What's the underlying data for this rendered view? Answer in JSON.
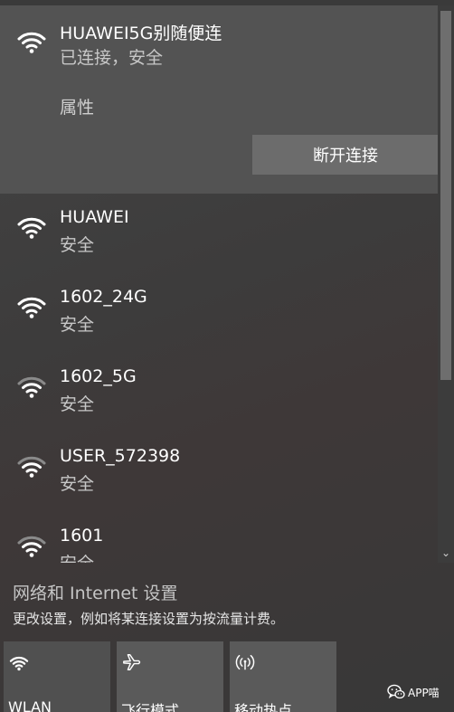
{
  "connected": {
    "name": "HUAWEI5G别随便连",
    "status": "已连接，安全",
    "properties_label": "属性",
    "disconnect_label": "断开连接",
    "icon": "wifi-strong-icon"
  },
  "networks": [
    {
      "name": "HUAWEI",
      "status": "安全",
      "icon": "wifi-strong-icon"
    },
    {
      "name": "1602_24G",
      "status": "安全",
      "icon": "wifi-strong-icon"
    },
    {
      "name": "1602_5G",
      "status": "安全",
      "icon": "wifi-medium-icon"
    },
    {
      "name": "USER_572398",
      "status": "安全",
      "icon": "wifi-medium-icon"
    },
    {
      "name": "1601",
      "status": "安全",
      "icon": "wifi-medium-icon"
    }
  ],
  "settings": {
    "title": "网络和 Internet 设置",
    "description": "更改设置，例如将某连接设置为按流量计费。"
  },
  "quick_actions": [
    {
      "label": "WLAN",
      "icon": "wifi-icon",
      "active": true,
      "color": "#505050"
    },
    {
      "label": "飞行模式",
      "icon": "airplane-icon",
      "active": false,
      "color": "#5a5a5a"
    },
    {
      "label": "移动热点",
      "icon": "hotspot-icon",
      "active": false,
      "color": "#5a5a5a"
    }
  ],
  "watermark": {
    "text": "APP喵",
    "icon": "wechat-icon"
  },
  "colors": {
    "panel_bg": "#3d3c3c",
    "connected_bg": "#535353",
    "button_bg": "#6c6c6c",
    "text_secondary": "#c7c7c7"
  }
}
